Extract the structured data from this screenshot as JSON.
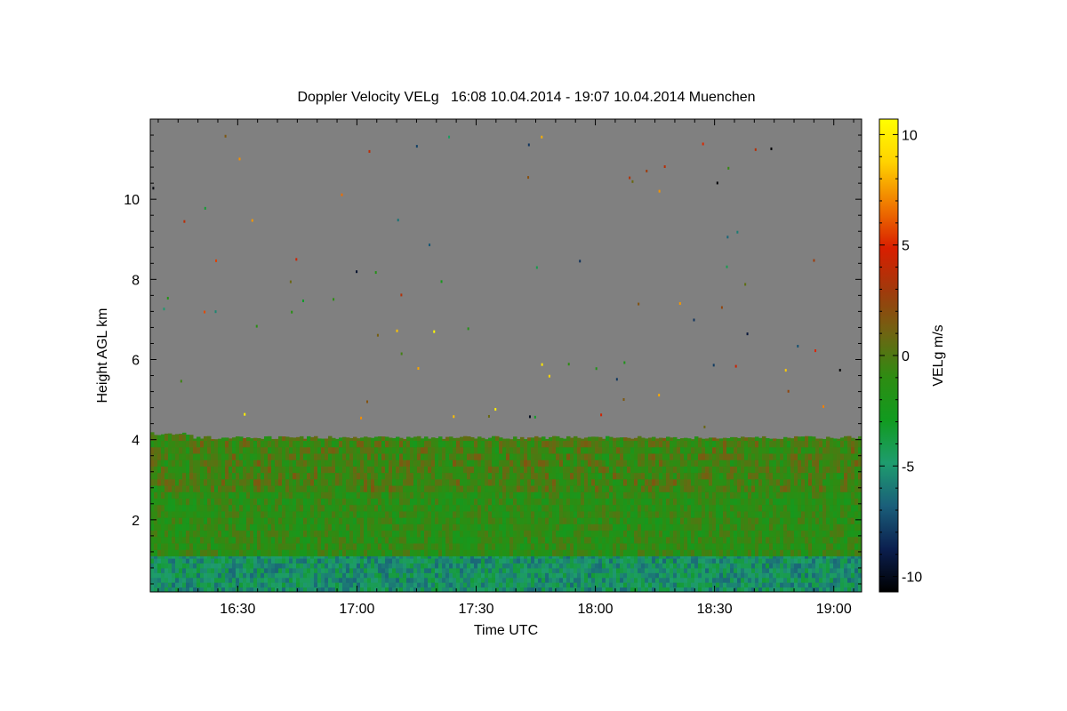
{
  "chart_data": {
    "type": "heatmap",
    "title": "Doppler Velocity VELg   16:08 10.04.2014 - 19:07 10.04.2014 Muenchen",
    "xlabel": "Time UTC",
    "ylabel": "Height AGL km",
    "colorbar_label": "VELg m/s",
    "x_range_min": [
      968,
      1147
    ],
    "x_ticks": [
      {
        "min": 990,
        "label": "16:30"
      },
      {
        "min": 1020,
        "label": "17:00"
      },
      {
        "min": 1050,
        "label": "17:30"
      },
      {
        "min": 1080,
        "label": "18:00"
      },
      {
        "min": 1110,
        "label": "18:30"
      },
      {
        "min": 1140,
        "label": "19:00"
      }
    ],
    "ylim": [
      0.2,
      12.0
    ],
    "y_ticks": [
      2,
      4,
      6,
      8,
      10
    ],
    "clim": [
      -10.7,
      10.7
    ],
    "c_ticks": [
      -10,
      -5,
      0,
      5,
      10
    ],
    "grid": false,
    "background_color": "#808080",
    "colormap": [
      "#000000",
      "#0b1f4f",
      "#1a5f7a",
      "#1e9c6e",
      "#119b1f",
      "#2e8c12",
      "#6e6512",
      "#a03a0c",
      "#d91e00",
      "#f07a00",
      "#ffd200",
      "#ffff00"
    ],
    "layers": [
      {
        "z_min": 0.2,
        "z_max": 1.1,
        "mean_velocity": -5.0
      },
      {
        "z_min": 1.1,
        "z_max": 4.05,
        "mean_velocity": -1.2
      }
    ]
  }
}
